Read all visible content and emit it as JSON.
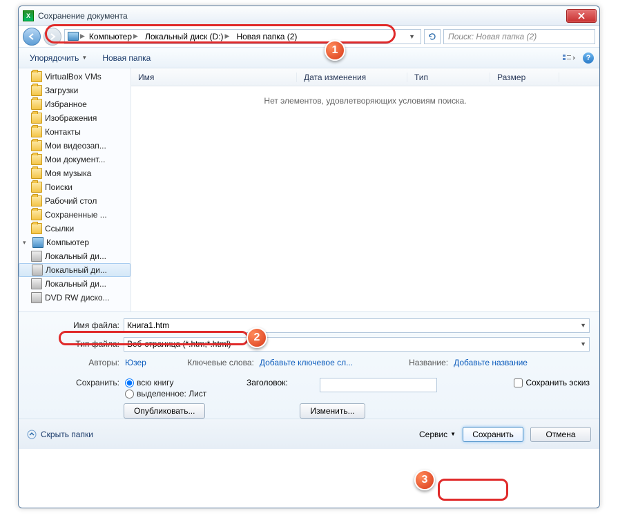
{
  "title": "Сохранение документа",
  "breadcrumb": {
    "seg1": "Компьютер",
    "seg2": "Локальный диск (D:)",
    "seg3": "Новая папка (2)"
  },
  "search": {
    "placeholder": "Поиск: Новая папка (2)"
  },
  "toolbar": {
    "organize": "Упорядочить",
    "newfolder": "Новая папка"
  },
  "tree": {
    "items": [
      "VirtualBox VMs",
      "Загрузки",
      "Избранное",
      "Изображения",
      "Контакты",
      "Мои видеозап...",
      "Мои документ...",
      "Моя музыка",
      "Поиски",
      "Рабочий стол",
      "Сохраненные ...",
      "Ссылки"
    ],
    "computer": "Компьютер",
    "drives": [
      "Локальный ди...",
      "Локальный ди...",
      "Локальный ди...",
      "DVD RW диско..."
    ]
  },
  "cols": {
    "name": "Имя",
    "date": "Дата изменения",
    "type": "Тип",
    "size": "Размер"
  },
  "empty": "Нет элементов, удовлетворяющих условиям поиска.",
  "form": {
    "filename_label": "Имя файла:",
    "filename": "Книга1.htm",
    "filetype_label": "Тип файла:",
    "filetype": "Веб-страница (*.htm;*.html)",
    "authors_label": "Авторы:",
    "authors": "Юзер",
    "keywords_label": "Ключевые слова:",
    "keywords_add": "Добавьте ключевое сл...",
    "title_label": "Название:",
    "title_add": "Добавьте название",
    "save_label": "Сохранить:",
    "radio_book": "всю книгу",
    "radio_sheet": "выделенное: Лист",
    "header_label": "Заголовок:",
    "thumb": "Сохранить эскиз",
    "publish": "Опубликовать...",
    "change": "Изменить..."
  },
  "footer": {
    "hide": "Скрыть папки",
    "service": "Сервис",
    "save": "Сохранить",
    "cancel": "Отмена"
  },
  "badges": {
    "n1": "1",
    "n2": "2",
    "n3": "3"
  }
}
